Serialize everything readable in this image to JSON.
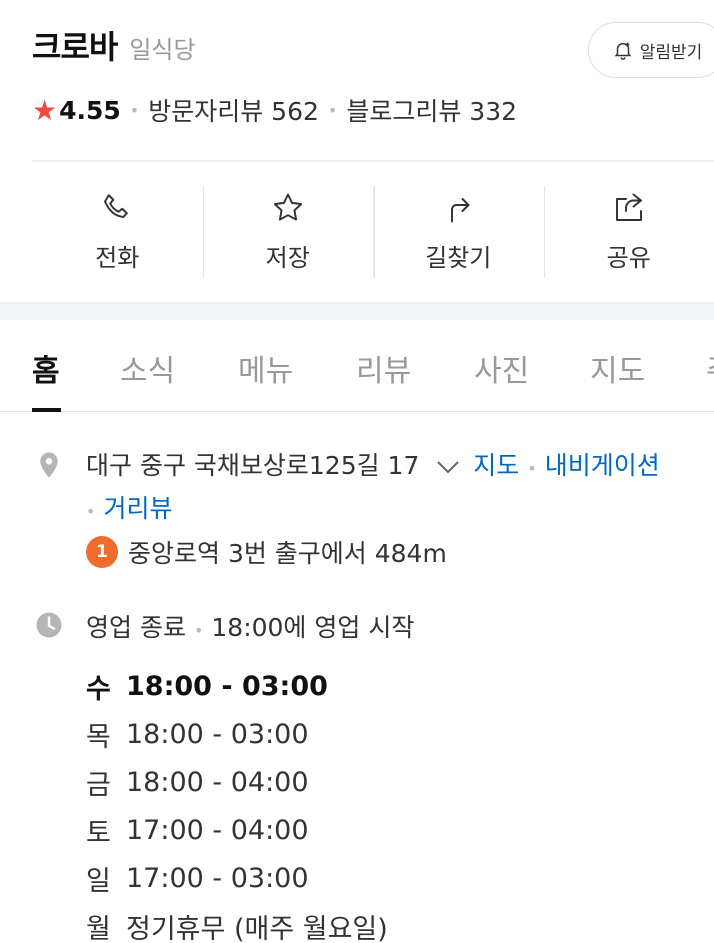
{
  "place": {
    "name": "크로바",
    "category": "일식당",
    "alarm_label": "알림받기",
    "rating": "4.55",
    "visitor_reviews": "방문자리뷰 562",
    "blog_reviews": "블로그리뷰 332"
  },
  "actions": [
    {
      "label": "전화",
      "icon": "phone-icon"
    },
    {
      "label": "저장",
      "icon": "star-icon"
    },
    {
      "label": "길찾기",
      "icon": "directions-icon"
    },
    {
      "label": "공유",
      "icon": "share-icon"
    }
  ],
  "tabs": [
    "홈",
    "소식",
    "메뉴",
    "리뷰",
    "사진",
    "지도",
    "주"
  ],
  "address": {
    "text": "대구 중구 국채보상로125길 17",
    "map_link": "지도",
    "navi_link": "내비게이션",
    "street_view_link": "거리뷰"
  },
  "subway": {
    "line": "1",
    "text": "중앙로역 3번 출구에서 484m",
    "line_color": "#f06c2c"
  },
  "business": {
    "status": "영업 종료",
    "next": "18:00에 영업 시작"
  },
  "hours": [
    {
      "day": "수",
      "time": "18:00 - 03:00"
    },
    {
      "day": "목",
      "time": "18:00 - 03:00"
    },
    {
      "day": "금",
      "time": "18:00 - 04:00"
    },
    {
      "day": "토",
      "time": "17:00 - 04:00"
    },
    {
      "day": "일",
      "time": "17:00 - 03:00"
    },
    {
      "day": "월",
      "time": "정기휴무 (매주 월요일)"
    }
  ],
  "colors": {
    "accent_star": "#f0483e",
    "link": "#0068c3"
  }
}
